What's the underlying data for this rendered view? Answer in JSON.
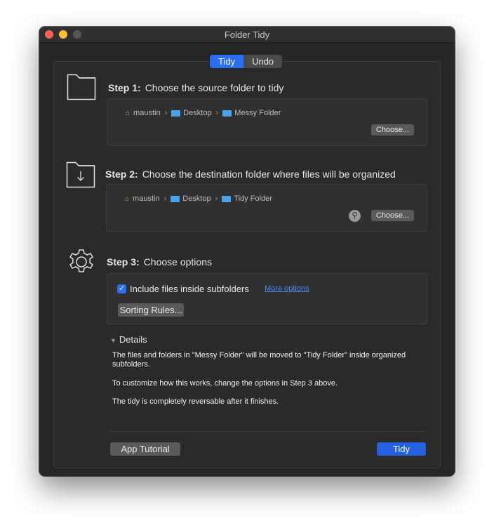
{
  "window": {
    "title": "Folder Tidy"
  },
  "segmented": {
    "tidy_label": "Tidy",
    "undo_label": "Undo",
    "active": "Tidy"
  },
  "step1": {
    "number": "Step 1:",
    "title": "Choose the source folder to tidy",
    "icon": "folder-icon",
    "path": [
      "maustin",
      "Desktop",
      "Messy Folder"
    ],
    "choose_label": "Choose..."
  },
  "step2": {
    "number": "Step 2:",
    "title": "Choose the destination folder where files will be organized",
    "icon": "folder-download-icon",
    "path": [
      "maustin",
      "Desktop",
      "Tidy Folder"
    ],
    "choose_label": "Choose..."
  },
  "step3": {
    "number": "Step 3:",
    "title": "Choose options",
    "icon": "gear-icon",
    "checkbox_label": "Include files inside subfolders",
    "checkbox_checked": true,
    "more_options_label": "More options",
    "sorting_rules_label": "Sorting Rules..."
  },
  "details": {
    "label": "Details",
    "line1": "The files and folders in \"Messy Folder\" will be moved to \"Tidy Folder\" inside organized subfolders.",
    "line2": "To customize how this works, change the options in Step 3 above.",
    "line3": "The tidy is completely reversable after it finishes."
  },
  "footer": {
    "tutorial_label": "App Tutorial",
    "tidy_label": "Tidy"
  },
  "colors": {
    "accent": "#2a6ef2",
    "primary_button": "#2560e0",
    "link": "#4a8cf2"
  }
}
